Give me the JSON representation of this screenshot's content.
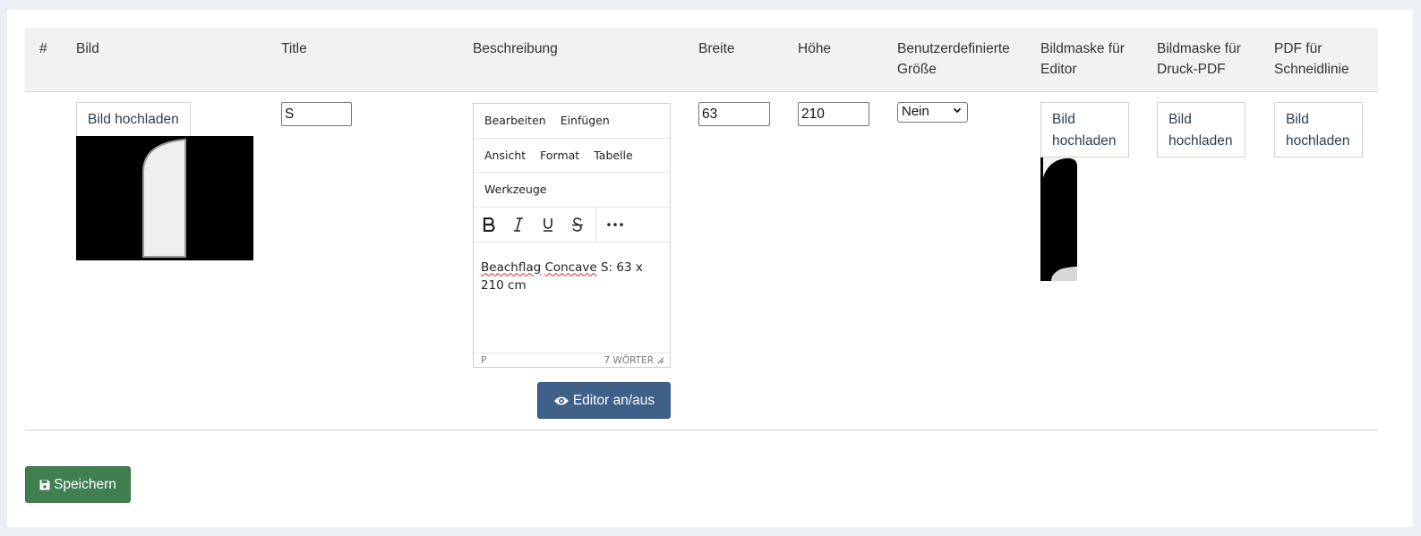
{
  "table": {
    "headers": {
      "index": "#",
      "image": "Bild",
      "title": "Title",
      "description": "Beschreibung",
      "width": "Breite",
      "height": "Höhe",
      "custom_size_l1": "Benutzerdefinierte",
      "custom_size_l2": "Größe",
      "editor_mask_l1": "Bildmaske für",
      "editor_mask_l2": "Editor",
      "print_mask_l1": "Bildmaske für",
      "print_mask_l2": "Druck-PDF",
      "cutline_l1": "PDF für",
      "cutline_l2": "Schneidlinie"
    },
    "row": {
      "image_upload_label": "Bild hochladen",
      "title_value": "S",
      "width_value": "63",
      "height_value": "210",
      "custom_size_selected": "Nein",
      "upload_l1": "Bild",
      "upload_l2": "hochladen"
    }
  },
  "editor": {
    "menu_row1": [
      "Bearbeiten",
      "Einfügen"
    ],
    "menu_row2": [
      "Ansicht",
      "Format",
      "Tabelle"
    ],
    "menu_row3": [
      "Werkzeuge"
    ],
    "toolbar_icons": [
      "bold-icon",
      "italic-icon",
      "underline-icon",
      "strikethrough-icon",
      "more-icon"
    ],
    "content_word1": "Beachflag",
    "content_word2": "Concave",
    "content_rest": " S: 63 x 210 cm",
    "status_path": "P",
    "word_count": "7 WÖRTER",
    "toggle_label": "Editor an/aus"
  },
  "actions": {
    "save_label": "Speichern"
  },
  "colors": {
    "toggle_button": "#3e6089",
    "save_button": "#3f7f50",
    "header_bg": "#f2f2f2"
  }
}
